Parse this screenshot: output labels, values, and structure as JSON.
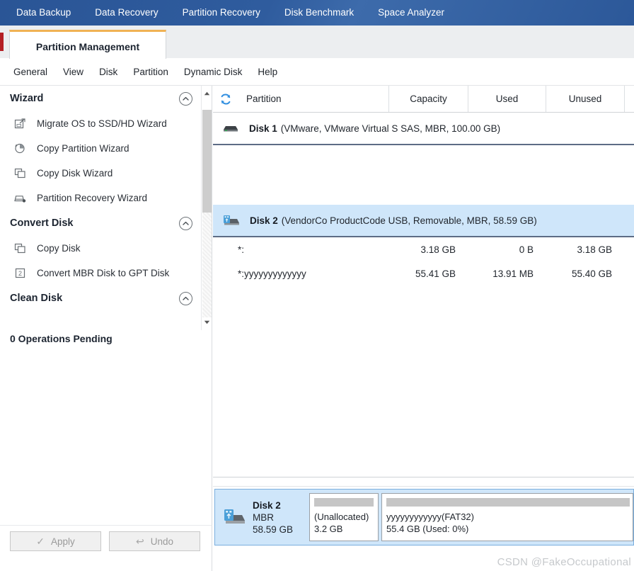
{
  "navbar": {
    "items": [
      {
        "label": "Data Backup"
      },
      {
        "label": "Data Recovery"
      },
      {
        "label": "Partition Recovery"
      },
      {
        "label": "Disk Benchmark"
      },
      {
        "label": "Space Analyzer"
      }
    ]
  },
  "tab": {
    "active_label": "Partition Management"
  },
  "menubar": {
    "items": [
      {
        "label": "General"
      },
      {
        "label": "View"
      },
      {
        "label": "Disk"
      },
      {
        "label": "Partition"
      },
      {
        "label": "Dynamic Disk"
      },
      {
        "label": "Help"
      }
    ]
  },
  "sidebar": {
    "sections": [
      {
        "title": "Wizard",
        "items": [
          {
            "label": "Migrate OS to SSD/HD Wizard",
            "icon": "migrate-os-icon"
          },
          {
            "label": "Copy Partition Wizard",
            "icon": "copy-partition-icon"
          },
          {
            "label": "Copy Disk Wizard",
            "icon": "copy-disk-icon"
          },
          {
            "label": "Partition Recovery Wizard",
            "icon": "partition-recovery-icon"
          }
        ]
      },
      {
        "title": "Convert Disk",
        "items": [
          {
            "label": "Copy Disk",
            "icon": "copy-disk-icon"
          },
          {
            "label": "Convert MBR Disk to GPT Disk",
            "icon": "convert-mbr-gpt-icon"
          }
        ]
      },
      {
        "title": "Clean Disk",
        "items": []
      }
    ],
    "operations_pending": "0 Operations Pending"
  },
  "actionbar": {
    "apply_label": "Apply",
    "undo_label": "Undo"
  },
  "table": {
    "refresh_icon": "refresh-icon",
    "columns": [
      "Partition",
      "Capacity",
      "Used",
      "Unused"
    ],
    "disks": [
      {
        "name": "Disk 1",
        "meta": "(VMware, VMware Virtual S SAS, MBR, 100.00 GB)",
        "icon": "hard-disk-icon",
        "selected": false,
        "partitions": []
      },
      {
        "name": "Disk 2",
        "meta": "(VendorCo ProductCode USB, Removable, MBR, 58.59 GB)",
        "icon": "usb-disk-icon",
        "selected": true,
        "partitions": [
          {
            "partition": "*:",
            "capacity": "3.18 GB",
            "used": "0 B",
            "unused": "3.18 GB"
          },
          {
            "partition": "*:yyyyyyyyyyyyy",
            "capacity": "55.41 GB",
            "used": "13.91 MB",
            "unused": "55.40 GB"
          }
        ]
      }
    ]
  },
  "diskmap": {
    "disk": {
      "name": "Disk 2",
      "scheme": "MBR",
      "size": "58.59 GB",
      "icon": "usb-disk-icon"
    },
    "partitions": [
      {
        "line1": "(Unallocated)",
        "line2": "3.2 GB"
      },
      {
        "line1": "yyyyyyyyyyyy(FAT32)",
        "line2": "55.4 GB (Used: 0%)"
      }
    ]
  },
  "watermark": {
    "text": "CSDN @FakeOccupational"
  },
  "colors": {
    "navbar": "#2f5c9e",
    "tab_accent": "#f0b254",
    "selection": "#cfe6fa",
    "refresh_blue": "#2f8ee0"
  }
}
